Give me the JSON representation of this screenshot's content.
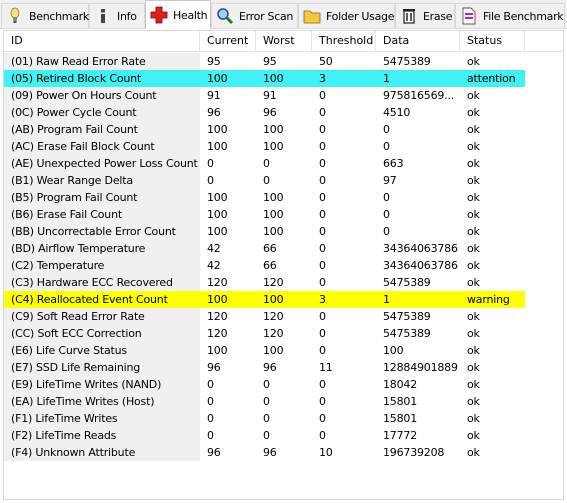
{
  "tabs": [
    {
      "label": "Benchmark",
      "icon": "bulb-icon"
    },
    {
      "label": "Info",
      "icon": "info-icon"
    },
    {
      "label": "Health",
      "icon": "health-cross-icon",
      "active": true
    },
    {
      "label": "Error Scan",
      "icon": "magnifier-icon"
    },
    {
      "label": "Folder Usage",
      "icon": "folder-icon"
    },
    {
      "label": "Erase",
      "icon": "trash-icon"
    },
    {
      "label": "File Benchmark",
      "icon": "document-icon"
    }
  ],
  "table": {
    "headers": {
      "id": "ID",
      "current": "Current",
      "worst": "Worst",
      "threshold": "Threshold",
      "data": "Data",
      "status": "Status"
    },
    "rows": [
      {
        "id": "(01) Raw Read Error Rate",
        "current": "95",
        "worst": "95",
        "threshold": "50",
        "data": "5475389",
        "status": "ok"
      },
      {
        "id": "(05) Retired Block Count",
        "current": "100",
        "worst": "100",
        "threshold": "3",
        "data": "1",
        "status": "attention",
        "highlight": "#3ff0f5"
      },
      {
        "id": "(09) Power On Hours Count",
        "current": "91",
        "worst": "91",
        "threshold": "0",
        "data": "975816569...",
        "status": "ok"
      },
      {
        "id": "(0C) Power Cycle Count",
        "current": "96",
        "worst": "96",
        "threshold": "0",
        "data": "4510",
        "status": "ok"
      },
      {
        "id": "(AB) Program Fail Count",
        "current": "100",
        "worst": "100",
        "threshold": "0",
        "data": "0",
        "status": "ok"
      },
      {
        "id": "(AC) Erase Fail Block Count",
        "current": "100",
        "worst": "100",
        "threshold": "0",
        "data": "0",
        "status": "ok"
      },
      {
        "id": "(AE) Unexpected Power Loss Count",
        "current": "0",
        "worst": "0",
        "threshold": "0",
        "data": "663",
        "status": "ok"
      },
      {
        "id": "(B1) Wear Range Delta",
        "current": "0",
        "worst": "0",
        "threshold": "0",
        "data": "97",
        "status": "ok"
      },
      {
        "id": "(B5) Program Fail Count",
        "current": "100",
        "worst": "100",
        "threshold": "0",
        "data": "0",
        "status": "ok"
      },
      {
        "id": "(B6) Erase Fail Count",
        "current": "100",
        "worst": "100",
        "threshold": "0",
        "data": "0",
        "status": "ok"
      },
      {
        "id": "(BB) Uncorrectable Error Count",
        "current": "100",
        "worst": "100",
        "threshold": "0",
        "data": "0",
        "status": "ok"
      },
      {
        "id": "(BD) Airflow Temperature",
        "current": "42",
        "worst": "66",
        "threshold": "0",
        "data": "34364063786",
        "status": "ok"
      },
      {
        "id": "(C2) Temperature",
        "current": "42",
        "worst": "66",
        "threshold": "0",
        "data": "34364063786",
        "status": "ok"
      },
      {
        "id": "(C3) Hardware ECC Recovered",
        "current": "120",
        "worst": "120",
        "threshold": "0",
        "data": "5475389",
        "status": "ok"
      },
      {
        "id": "(C4) Reallocated Event Count",
        "current": "100",
        "worst": "100",
        "threshold": "3",
        "data": "1",
        "status": "warning",
        "highlight": "#ffff00"
      },
      {
        "id": "(C9) Soft Read Error Rate",
        "current": "120",
        "worst": "120",
        "threshold": "0",
        "data": "5475389",
        "status": "ok"
      },
      {
        "id": "(CC) Soft ECC Correction",
        "current": "120",
        "worst": "120",
        "threshold": "0",
        "data": "5475389",
        "status": "ok"
      },
      {
        "id": "(E6) Life Curve Status",
        "current": "100",
        "worst": "100",
        "threshold": "0",
        "data": "100",
        "status": "ok"
      },
      {
        "id": "(E7) SSD Life Remaining",
        "current": "96",
        "worst": "96",
        "threshold": "11",
        "data": "12884901889",
        "status": "ok"
      },
      {
        "id": "(E9) LifeTime Writes (NAND)",
        "current": "0",
        "worst": "0",
        "threshold": "0",
        "data": "18042",
        "status": "ok"
      },
      {
        "id": "(EA) LifeTime Writes (Host)",
        "current": "0",
        "worst": "0",
        "threshold": "0",
        "data": "15801",
        "status": "ok"
      },
      {
        "id": "(F1) LifeTime Writes",
        "current": "0",
        "worst": "0",
        "threshold": "0",
        "data": "15801",
        "status": "ok"
      },
      {
        "id": "(F2) LifeTime Reads",
        "current": "0",
        "worst": "0",
        "threshold": "0",
        "data": "17772",
        "status": "ok"
      },
      {
        "id": "(F4) Unknown Attribute",
        "current": "96",
        "worst": "96",
        "threshold": "10",
        "data": "196739208",
        "status": "ok"
      }
    ]
  }
}
